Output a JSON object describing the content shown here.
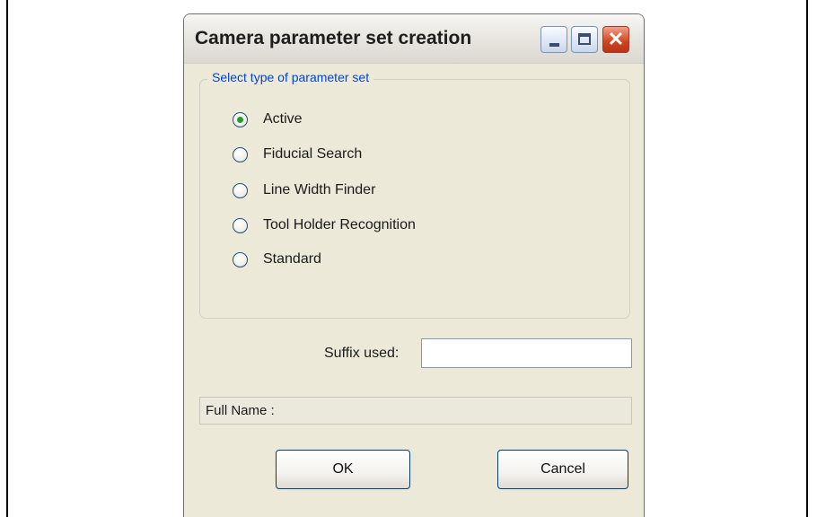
{
  "window": {
    "title": "Camera parameter set creation",
    "controls": {
      "minimize": "minimize-icon",
      "maximize": "maximize-icon",
      "close": "close-icon"
    }
  },
  "group": {
    "legend": "Select type of parameter set",
    "options": [
      {
        "label": "Active",
        "selected": true
      },
      {
        "label": "Fiducial Search",
        "selected": false
      },
      {
        "label": "Line Width Finder",
        "selected": false
      },
      {
        "label": "Tool Holder Recognition",
        "selected": false
      },
      {
        "label": "Standard",
        "selected": false
      }
    ]
  },
  "suffix": {
    "label": "Suffix used:",
    "value": ""
  },
  "full_name": {
    "label": "Full Name :"
  },
  "buttons": {
    "ok": "OK",
    "cancel": "Cancel"
  },
  "colors": {
    "legend_text": "#0046d5",
    "radio_selected": "#21a121",
    "window_bg": "#ece9d8"
  }
}
